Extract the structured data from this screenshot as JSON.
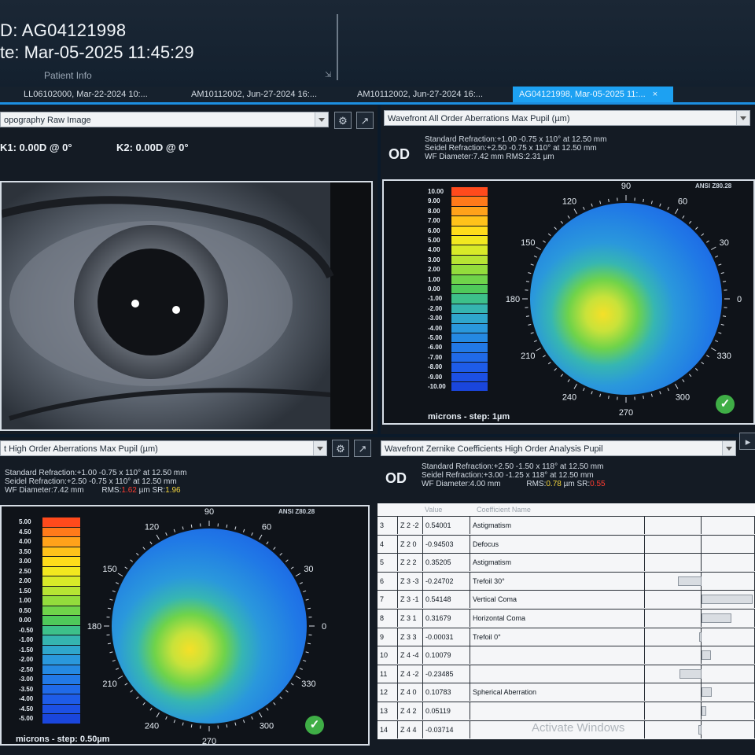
{
  "patient": {
    "id_line": "D: AG04121998",
    "date_line": "te: Mar-05-2025 11:45:29",
    "info_label": "Patient Info"
  },
  "tabs": [
    {
      "label": "LL06102000, Mar-22-2024 10:...",
      "active": false
    },
    {
      "label": "AM10112002, Jun-27-2024 16:...",
      "active": false
    },
    {
      "label": "AM10112002, Jun-27-2024 16:...",
      "active": false
    },
    {
      "label": "AG04121998, Mar-05-2025 11:...",
      "active": true
    }
  ],
  "top_left": {
    "dropdown": "opography Raw Image",
    "k1": "K1: 0.00D @ 0°",
    "k2": "K2: 0.00D @ 0°"
  },
  "top_right": {
    "dropdown": "Wavefront All Order Aberrations Max Pupil (µm)",
    "eye": "OD",
    "standard_refraction": "Standard Refraction:+1.00 -0.75 x 110° at 12.50 mm",
    "seidel_refraction": "Seidel Refraction:+2.50 -0.75 x 110° at 12.50 mm",
    "wf_line": "WF Diameter:7.42 mm    RMS:2.31 µm",
    "ansi": "ANSI Z80.28",
    "scale_labels": [
      "10.00",
      "9.00",
      "8.00",
      "7.00",
      "6.00",
      "5.00",
      "4.00",
      "3.00",
      "2.00",
      "1.00",
      "0.00",
      "-1.00",
      "-2.00",
      "-3.00",
      "-4.00",
      "-5.00",
      "-6.00",
      "-7.00",
      "-8.00",
      "-9.00",
      "-10.00"
    ],
    "micron_label": "microns - step: 1µm",
    "angles": [
      "90",
      "60",
      "30",
      "0",
      "330",
      "300",
      "270",
      "240",
      "210",
      "180",
      "150",
      "120"
    ]
  },
  "bottom_left": {
    "dropdown": "t High Order Aberrations Max Pupil (µm)",
    "standard_refraction": "Standard Refraction:+1.00 -0.75 x 110° at 12.50 mm",
    "seidel_refraction": "Seidel Refraction:+2.50 -0.75 x 110° at 12.50 mm",
    "wf_diameter": "WF Diameter:7.42 mm",
    "rms_label": "RMS:",
    "rms_value": "1.62",
    "sr_label": "µm SR:",
    "sr_value": "1.96",
    "ansi": "ANSI Z80.28",
    "scale_labels": [
      "5.00",
      "4.50",
      "4.00",
      "3.50",
      "3.00",
      "2.50",
      "2.00",
      "1.50",
      "1.00",
      "0.50",
      "0.00",
      "-0.50",
      "-1.00",
      "-1.50",
      "-2.00",
      "-2.50",
      "-3.00",
      "-3.50",
      "-4.00",
      "-4.50",
      "-5.00"
    ],
    "micron_label": "microns - step: 0.50µm",
    "angles": [
      "90",
      "60",
      "30",
      "0",
      "330",
      "300",
      "270",
      "240",
      "210",
      "180",
      "150",
      "120"
    ]
  },
  "bottom_right": {
    "dropdown": "Wavefront Zernike Coefficients High Order Analysis Pupil",
    "eye": "OD",
    "standard_refraction": "Standard Refraction:+2.50 -1.50 x 118° at 12.50 mm",
    "seidel_refraction": "Seidel Refraction:+3.00 -1.25 x 118° at 12.50 mm",
    "wf_diameter": "WF Diameter:4.00 mm",
    "rms_label": "RMS:",
    "rms_value": "0.78",
    "sr_label": "µm SR:",
    "sr_value": "0.55",
    "columns": [
      "",
      "",
      "Value",
      "Coefficient Name",
      "",
      ""
    ],
    "rows": [
      {
        "n": "3",
        "z": "Z 2 -2",
        "value": "0.54001",
        "name": "Astigmatism",
        "bar": 0
      },
      {
        "n": "4",
        "z": "Z 2 0",
        "value": "-0.94503",
        "name": "Defocus",
        "bar": 0
      },
      {
        "n": "5",
        "z": "Z 2 2",
        "value": "0.35205",
        "name": "Astigmatism",
        "bar": 0
      },
      {
        "n": "6",
        "z": "Z 3 -3",
        "value": "-0.24702",
        "name": "Trefoil 30°",
        "bar": -0.24702
      },
      {
        "n": "7",
        "z": "Z 3 -1",
        "value": "0.54148",
        "name": "Vertical Coma",
        "bar": 0.54148
      },
      {
        "n": "8",
        "z": "Z 3 1",
        "value": "0.31679",
        "name": "Horizontal Coma",
        "bar": 0.31679
      },
      {
        "n": "9",
        "z": "Z 3 3",
        "value": "-0.00031",
        "name": "Trefoil 0°",
        "bar": -0.00031
      },
      {
        "n": "10",
        "z": "Z 4 -4",
        "value": "0.10079",
        "name": "",
        "bar": 0.10079
      },
      {
        "n": "11",
        "z": "Z 4 -2",
        "value": "-0.23485",
        "name": "",
        "bar": -0.23485
      },
      {
        "n": "12",
        "z": "Z 4 0",
        "value": "0.10783",
        "name": "Spherical Aberration",
        "bar": 0.10783
      },
      {
        "n": "13",
        "z": "Z 4 2",
        "value": "0.05119",
        "name": "",
        "bar": 0.05119
      },
      {
        "n": "14",
        "z": "Z 4 4",
        "value": "-0.03714",
        "name": "",
        "bar": -0.03714
      }
    ]
  },
  "watermark": "Activate Windows",
  "colors": {
    "accent": "#1da1f2",
    "rms_high": "#ff3b30",
    "sr": "#f2d43d"
  }
}
